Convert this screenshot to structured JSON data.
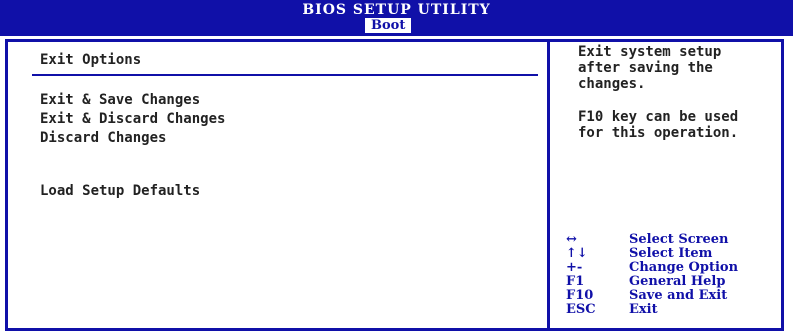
{
  "header": {
    "title": "BIOS SETUP UTILITY",
    "active_tab": "Boot"
  },
  "left_panel": {
    "section_title": "Exit Options",
    "items": [
      {
        "label": "Exit & Save Changes"
      },
      {
        "label": "Exit & Discard Changes"
      },
      {
        "label": "Discard Changes"
      },
      {
        "label": "Load Setup Defaults"
      }
    ]
  },
  "help_panel": {
    "lines": [
      "Exit system setup",
      "after saving the",
      "changes."
    ],
    "note_lines": [
      "F10 key can be used",
      "for this operation."
    ]
  },
  "key_legend": [
    {
      "key": "↔",
      "desc": "Select Screen"
    },
    {
      "key": "↑↓",
      "desc": "Select Item"
    },
    {
      "key": "+-",
      "desc": "Change Option"
    },
    {
      "key": "F1",
      "desc": "General Help"
    },
    {
      "key": "F10",
      "desc": "Save and Exit"
    },
    {
      "key": "ESC",
      "desc": "Exit"
    }
  ],
  "colors": {
    "bios_blue": "#1010a8",
    "background": "#ffffff",
    "text": "#222222"
  }
}
